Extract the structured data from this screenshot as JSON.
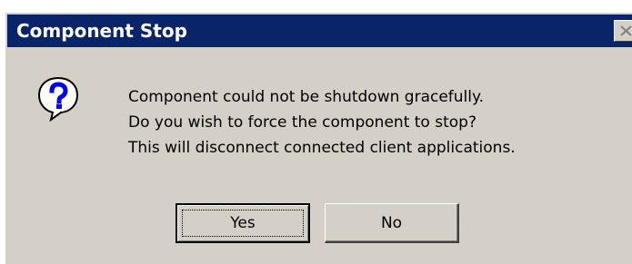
{
  "window": {
    "title": "Component Stop",
    "close_icon": "close-icon"
  },
  "message": {
    "icon": "question-icon",
    "lines": [
      "Component could not be shutdown gracefully.",
      "Do you wish to force the component to stop?",
      "This will disconnect connected client applications."
    ]
  },
  "buttons": {
    "yes_label": "Yes",
    "no_label": "No"
  },
  "colors": {
    "titlebar": "#0a246a",
    "dialog_face": "#d4d0c8",
    "icon_fill": "#ffffff",
    "icon_glyph": "#0000ff"
  }
}
